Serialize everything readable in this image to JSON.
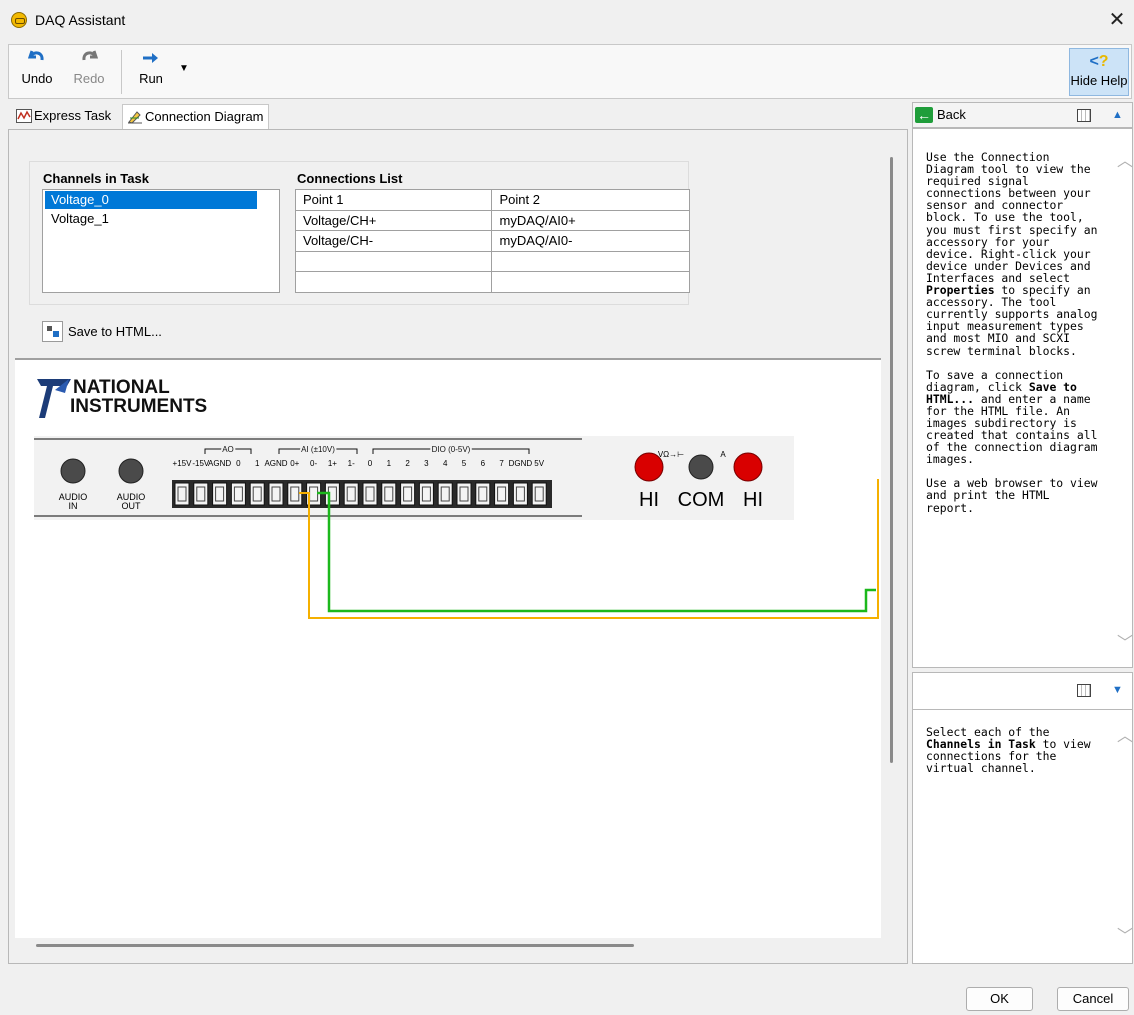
{
  "window": {
    "title": "DAQ Assistant",
    "close_label": "✕"
  },
  "toolbar": {
    "undo_label": "Undo",
    "redo_label": "Redo",
    "run_label": "Run",
    "hide_help_label": "Hide Help"
  },
  "tabs": [
    {
      "label": "Express Task",
      "active": false
    },
    {
      "label": "Connection Diagram",
      "active": true
    }
  ],
  "channels": {
    "heading": "Channels in Task",
    "items": [
      "Voltage_0",
      "Voltage_1"
    ],
    "selected": "Voltage_0"
  },
  "connections": {
    "heading": "Connections List",
    "columns": [
      "Point 1",
      "Point 2"
    ],
    "rows": [
      [
        "Voltage/CH+",
        "myDAQ/AI0+"
      ],
      [
        "Voltage/CH-",
        "myDAQ/AI0-"
      ],
      [
        "",
        ""
      ],
      [
        "",
        ""
      ]
    ]
  },
  "save_html_label": "Save to HTML...",
  "diagram": {
    "brand_line1": "NATIONAL",
    "brand_line2": "INSTRUMENTS",
    "audio_in_l1": "AUDIO",
    "audio_in_l2": "IN",
    "audio_out_l1": "AUDIO",
    "audio_out_l2": "OUT",
    "group_ao": "AO",
    "group_ai": "AI (±10V)",
    "group_dio": "DIO (0-5V)",
    "pin_labels": [
      "+15V",
      "-15V",
      "AGND",
      "0",
      "1",
      "AGND",
      "0+",
      "0-",
      "1+",
      "1-",
      "0",
      "1",
      "2",
      "3",
      "4",
      "5",
      "6",
      "7",
      "DGND",
      "5V"
    ],
    "dmm_top_left": "VΩ→⊢",
    "dmm_top_right": "A",
    "dmm_hi_left": "HI",
    "dmm_com": "COM",
    "dmm_hi_right": "HI",
    "wire_colors": {
      "positive": "#f5b000",
      "negative": "#1cb81c"
    },
    "jack_color": "#d90000"
  },
  "help": {
    "back_label": "Back",
    "para1_a": "Use the Connection Diagram tool to view the required signal connections between your sensor and connector block. To use the tool, you must first specify an accessory for your device. Right-click your device under Devices and Interfaces and select ",
    "para1_bold": "Properties",
    "para1_b": " to specify an accessory. The tool currently supports analog input measurement types and most MIO and SCXI screw terminal blocks.",
    "para2_a": "To save a connection diagram, click ",
    "para2_bold": "Save to HTML...",
    "para2_b": " and enter a name for the HTML file. An images subdirectory is created that contains all of the connection diagram images.",
    "para3": "Use a web browser to view and print the HTML report.",
    "context_a": "Select each of the ",
    "context_bold": "Channels in Task",
    "context_b": " to view connections for the virtual channel."
  },
  "footer": {
    "ok_label": "OK",
    "cancel_label": "Cancel"
  }
}
